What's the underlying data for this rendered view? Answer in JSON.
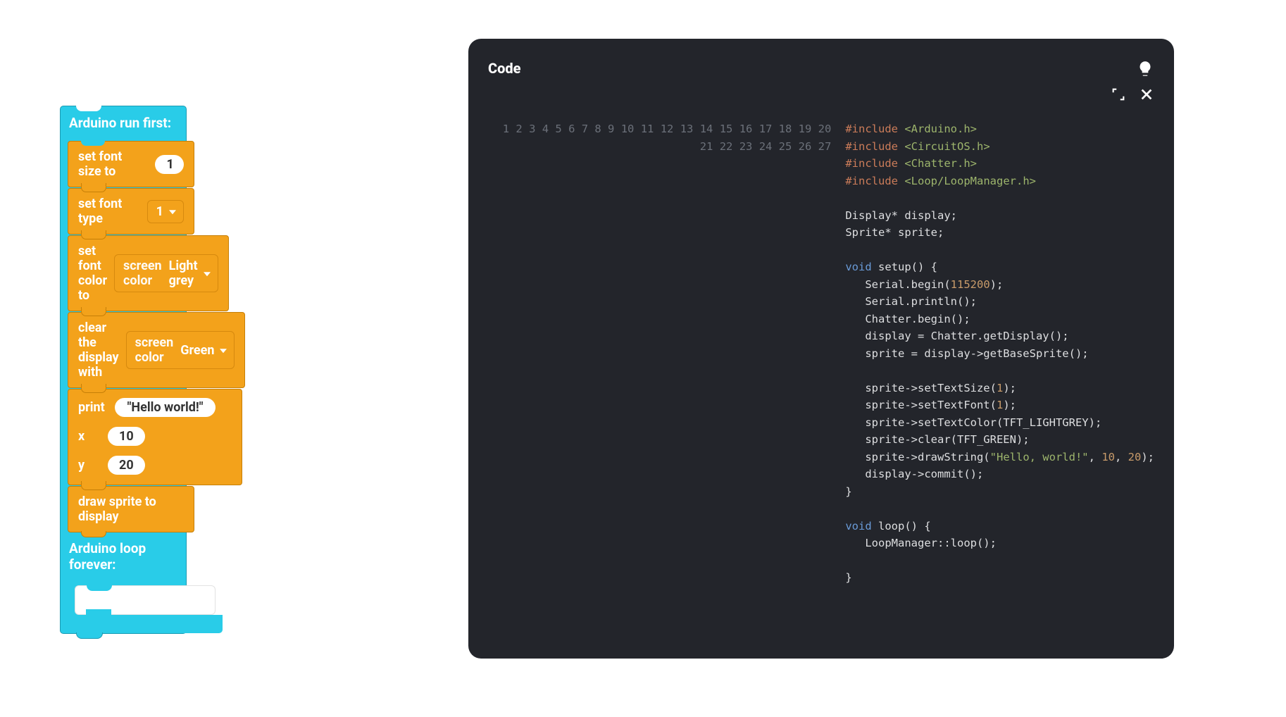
{
  "blocks": {
    "run_first_label": "Arduino run first:",
    "loop_forever_label": "Arduino loop forever:",
    "set_font_size_label": "set font size to",
    "set_font_size_value": "1",
    "set_font_type_label": "set font type",
    "set_font_type_value": "1",
    "set_font_color_label": "set font color to",
    "screen_color_kw": "screen color",
    "font_color_value": "Light grey",
    "clear_display_label": "clear the display with",
    "clear_display_color_value": "Green",
    "print_label": "print",
    "print_value": "\"Hello world!\"",
    "x_label": "x",
    "x_value": "10",
    "y_label": "y",
    "y_value": "20",
    "draw_sprite_label": "draw sprite to display"
  },
  "panel": {
    "title": "Code"
  },
  "code": {
    "lines": [
      {
        "n": 1,
        "seg": [
          {
            "c": "tk-dir",
            "t": "#include"
          },
          {
            "c": "",
            "t": " "
          },
          {
            "c": "tk-str",
            "t": "<Arduino.h>"
          }
        ]
      },
      {
        "n": 2,
        "seg": [
          {
            "c": "tk-dir",
            "t": "#include"
          },
          {
            "c": "",
            "t": " "
          },
          {
            "c": "tk-str",
            "t": "<CircuitOS.h>"
          }
        ]
      },
      {
        "n": 3,
        "seg": [
          {
            "c": "tk-dir",
            "t": "#include"
          },
          {
            "c": "",
            "t": " "
          },
          {
            "c": "tk-str",
            "t": "<Chatter.h>"
          }
        ]
      },
      {
        "n": 4,
        "seg": [
          {
            "c": "tk-dir",
            "t": "#include"
          },
          {
            "c": "",
            "t": " "
          },
          {
            "c": "tk-str",
            "t": "<Loop/LoopManager.h>"
          }
        ]
      },
      {
        "n": 5,
        "seg": [
          {
            "c": "",
            "t": ""
          }
        ]
      },
      {
        "n": 6,
        "seg": [
          {
            "c": "",
            "t": "Display* display;"
          }
        ]
      },
      {
        "n": 7,
        "seg": [
          {
            "c": "",
            "t": "Sprite* sprite;"
          }
        ]
      },
      {
        "n": 8,
        "seg": [
          {
            "c": "",
            "t": ""
          }
        ]
      },
      {
        "n": 9,
        "seg": [
          {
            "c": "tk-kw",
            "t": "void"
          },
          {
            "c": "",
            "t": " setup() {"
          }
        ]
      },
      {
        "n": 10,
        "seg": [
          {
            "c": "",
            "t": "   Serial.begin("
          },
          {
            "c": "tk-num",
            "t": "115200"
          },
          {
            "c": "",
            "t": ");"
          }
        ]
      },
      {
        "n": 11,
        "seg": [
          {
            "c": "",
            "t": "   Serial.println();"
          }
        ]
      },
      {
        "n": 12,
        "seg": [
          {
            "c": "",
            "t": "   Chatter.begin();"
          }
        ]
      },
      {
        "n": 13,
        "seg": [
          {
            "c": "",
            "t": "   display = Chatter.getDisplay();"
          }
        ]
      },
      {
        "n": 14,
        "seg": [
          {
            "c": "",
            "t": "   sprite = display->getBaseSprite();"
          }
        ]
      },
      {
        "n": 15,
        "seg": [
          {
            "c": "",
            "t": ""
          }
        ]
      },
      {
        "n": 16,
        "seg": [
          {
            "c": "",
            "t": "   sprite->setTextSize("
          },
          {
            "c": "tk-num",
            "t": "1"
          },
          {
            "c": "",
            "t": ");"
          }
        ]
      },
      {
        "n": 17,
        "seg": [
          {
            "c": "",
            "t": "   sprite->setTextFont("
          },
          {
            "c": "tk-num",
            "t": "1"
          },
          {
            "c": "",
            "t": ");"
          }
        ]
      },
      {
        "n": 18,
        "seg": [
          {
            "c": "",
            "t": "   sprite->setTextColor(TFT_LIGHTGREY);"
          }
        ]
      },
      {
        "n": 19,
        "seg": [
          {
            "c": "",
            "t": "   sprite->clear(TFT_GREEN);"
          }
        ]
      },
      {
        "n": 20,
        "seg": [
          {
            "c": "",
            "t": "   sprite->drawString("
          },
          {
            "c": "tk-str",
            "t": "\"Hello, world!\""
          },
          {
            "c": "",
            "t": ", "
          },
          {
            "c": "tk-num",
            "t": "10"
          },
          {
            "c": "",
            "t": ", "
          },
          {
            "c": "tk-num",
            "t": "20"
          },
          {
            "c": "",
            "t": ");"
          }
        ]
      },
      {
        "n": 21,
        "seg": [
          {
            "c": "",
            "t": "   display->commit();"
          }
        ]
      },
      {
        "n": 22,
        "seg": [
          {
            "c": "",
            "t": "}"
          }
        ]
      },
      {
        "n": 23,
        "seg": [
          {
            "c": "",
            "t": ""
          }
        ]
      },
      {
        "n": 24,
        "seg": [
          {
            "c": "tk-kw",
            "t": "void"
          },
          {
            "c": "",
            "t": " loop() {"
          }
        ]
      },
      {
        "n": 25,
        "seg": [
          {
            "c": "",
            "t": "   LoopManager::loop();"
          }
        ]
      },
      {
        "n": 26,
        "seg": [
          {
            "c": "",
            "t": ""
          }
        ]
      },
      {
        "n": 27,
        "seg": [
          {
            "c": "",
            "t": "}"
          }
        ]
      }
    ]
  }
}
